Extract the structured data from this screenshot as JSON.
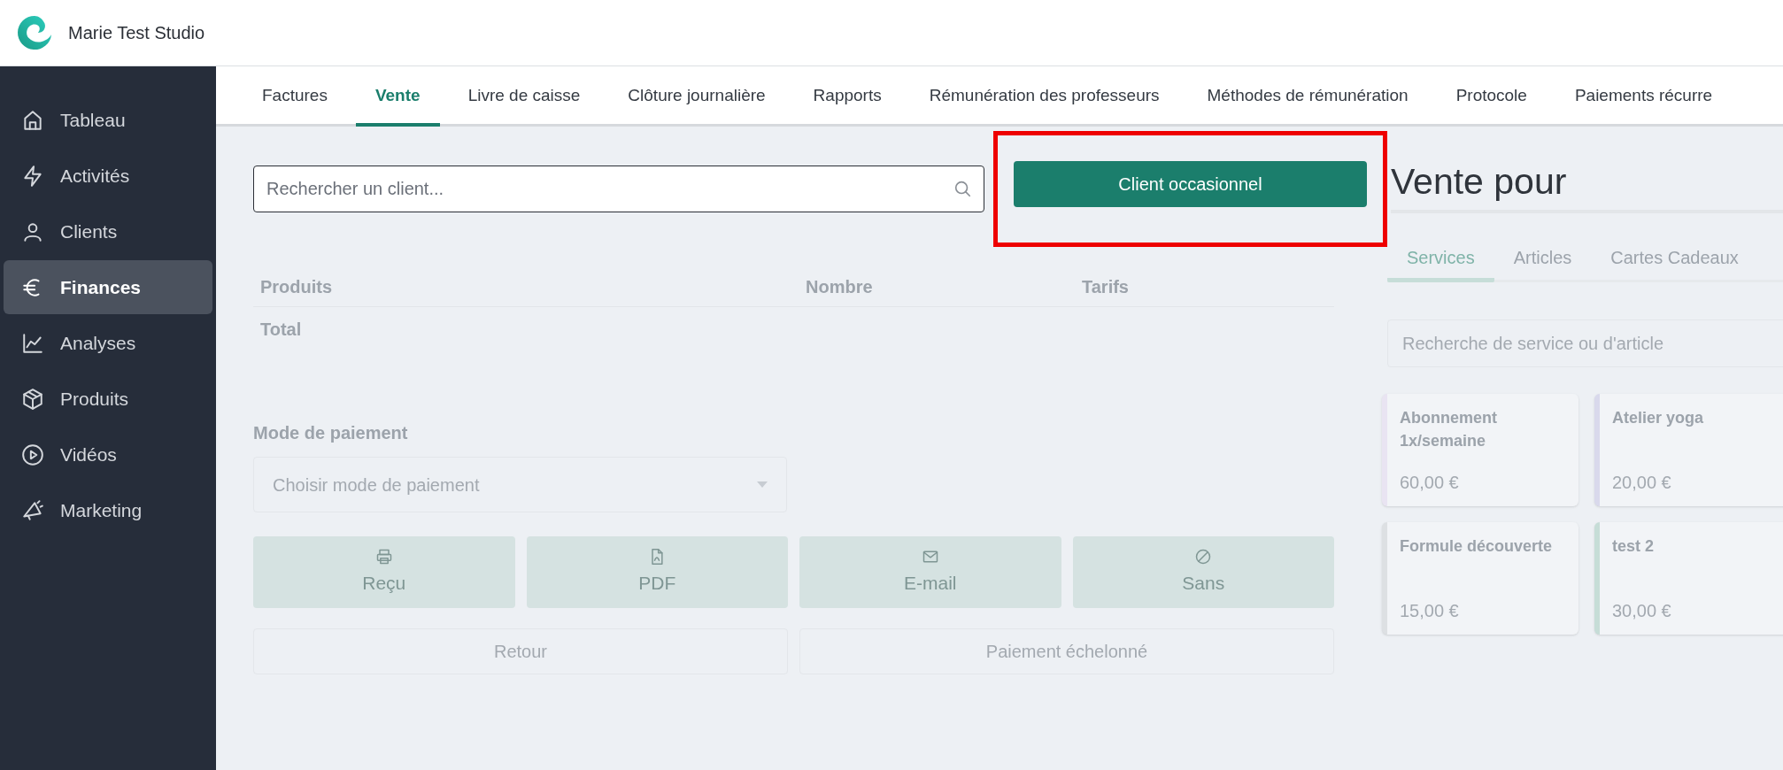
{
  "header": {
    "title": "Marie Test Studio"
  },
  "sidebar": {
    "items": [
      {
        "label": "Tableau",
        "selected": false
      },
      {
        "label": "Activités",
        "selected": false
      },
      {
        "label": "Clients",
        "selected": false
      },
      {
        "label": "Finances",
        "selected": true
      },
      {
        "label": "Analyses",
        "selected": false
      },
      {
        "label": "Produits",
        "selected": false
      },
      {
        "label": "Vidéos",
        "selected": false
      },
      {
        "label": "Marketing",
        "selected": false
      }
    ]
  },
  "tabs": [
    {
      "label": "Factures",
      "selected": false
    },
    {
      "label": "Vente",
      "selected": true
    },
    {
      "label": "Livre de caisse",
      "selected": false
    },
    {
      "label": "Clôture journalière",
      "selected": false
    },
    {
      "label": "Rapports",
      "selected": false
    },
    {
      "label": "Rémunération des professeurs",
      "selected": false
    },
    {
      "label": "Méthodes de rémunération",
      "selected": false
    },
    {
      "label": "Protocole",
      "selected": false
    },
    {
      "label": "Paiements récurre",
      "selected": false
    }
  ],
  "client_search": {
    "placeholder": "Rechercher un client..."
  },
  "walk_in_button": {
    "label": "Client occasionnel",
    "highlighted": true
  },
  "cart": {
    "columns": [
      "Produits",
      "Nombre",
      "Tarifs"
    ],
    "total_label": "Total"
  },
  "payment": {
    "label": "Mode de paiement",
    "placeholder": "Choisir mode de paiement"
  },
  "receipt_buttons": [
    {
      "label": "Reçu"
    },
    {
      "label": "PDF"
    },
    {
      "label": "E-mail"
    },
    {
      "label": "Sans"
    }
  ],
  "secondary_buttons": [
    "Retour",
    "Paiement échelonné"
  ],
  "sale_panel": {
    "title": "Vente pour",
    "tabs": [
      {
        "label": "Services",
        "selected": true
      },
      {
        "label": "Articles",
        "selected": false
      },
      {
        "label": "Cartes Cadeaux",
        "selected": false
      }
    ],
    "search": {
      "placeholder": "Recherche de service ou d'article"
    },
    "cards": [
      {
        "name": "Abonnement 1x/semaine",
        "price": "60,00 €",
        "color": "#e9e4f2"
      },
      {
        "name": "Atelier yoga",
        "price": "20,00 €",
        "color": "#d9d9ec"
      },
      {
        "name": "Formule découverte",
        "price": "15,00 €",
        "color": "#dde0e3"
      },
      {
        "name": "test 2",
        "price": "30,00 €",
        "color": "#c6ddd7"
      }
    ]
  }
}
